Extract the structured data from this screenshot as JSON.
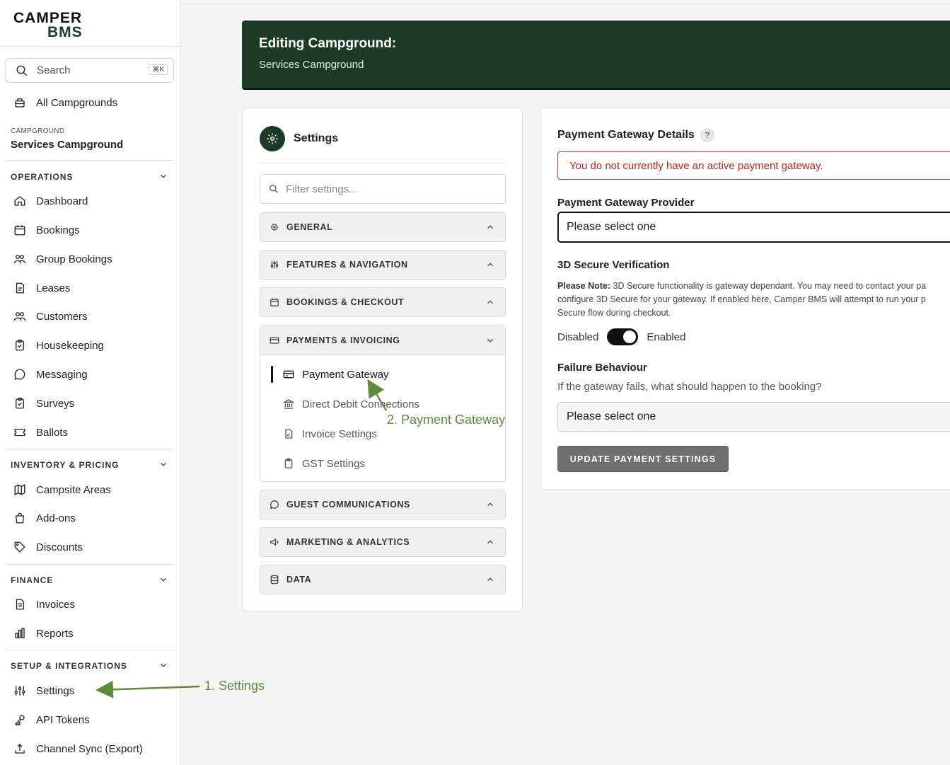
{
  "logo": {
    "line1": "CAMPER",
    "line2": "BMS"
  },
  "search": {
    "placeholder": "Search",
    "shortcut": "⌘K"
  },
  "sidebar": {
    "all_campgrounds": "All Campgrounds",
    "campground_label": "CAMPGROUND",
    "campground_name": "Services Campground",
    "sections": [
      {
        "title": "OPERATIONS",
        "items": [
          "Dashboard",
          "Bookings",
          "Group Bookings",
          "Leases",
          "Customers",
          "Housekeeping",
          "Messaging",
          "Surveys",
          "Ballots"
        ]
      },
      {
        "title": "INVENTORY & PRICING",
        "items": [
          "Campsite Areas",
          "Add-ons",
          "Discounts"
        ]
      },
      {
        "title": "FINANCE",
        "items": [
          "Invoices",
          "Reports"
        ]
      },
      {
        "title": "SETUP & INTEGRATIONS",
        "items": [
          "Settings",
          "API Tokens",
          "Channel Sync (Export)"
        ]
      }
    ]
  },
  "banner": {
    "title": "Editing Campground:",
    "subtitle": "Services Campground"
  },
  "settings": {
    "title": "Settings",
    "filter_placeholder": "Filter settings...",
    "groups": [
      "GENERAL",
      "FEATURES & NAVIGATION",
      "BOOKINGS & CHECKOUT",
      "PAYMENTS & INVOICING",
      "GUEST COMMUNICATIONS",
      "MARKETING & ANALYTICS",
      "DATA"
    ],
    "payments_items": [
      "Payment Gateway",
      "Direct Debit Connections",
      "Invoice Settings",
      "GST Settings"
    ]
  },
  "gateway": {
    "title": "Payment Gateway Details",
    "help": "?",
    "alert": "You do not currently have an active payment gateway.",
    "provider_label": "Payment Gateway Provider",
    "provider_value": "Please select one",
    "secure_label": "3D Secure Verification",
    "note_bold": "Please Note:",
    "note_line1": " 3D Secure functionality is gateway dependant. You may need to contact your pa",
    "note_line2": "configure 3D Secure for your gateway. If enabled here, Camper BMS will attempt to run your p",
    "note_line3": "Secure flow during checkout.",
    "toggle_off": "Disabled",
    "toggle_on": "Enabled",
    "failure_label": "Failure Behaviour",
    "failure_sub": "If the gateway fails, what should happen to the booking?",
    "failure_value": "Please select one",
    "update_button": "UPDATE PAYMENT SETTINGS"
  },
  "annotations": {
    "step1": "1. Settings",
    "step2": "2. Payment Gateway"
  },
  "colors": {
    "brand": "#1d3a25",
    "alert": "#b3261e",
    "annotation": "#5b8c3a"
  }
}
